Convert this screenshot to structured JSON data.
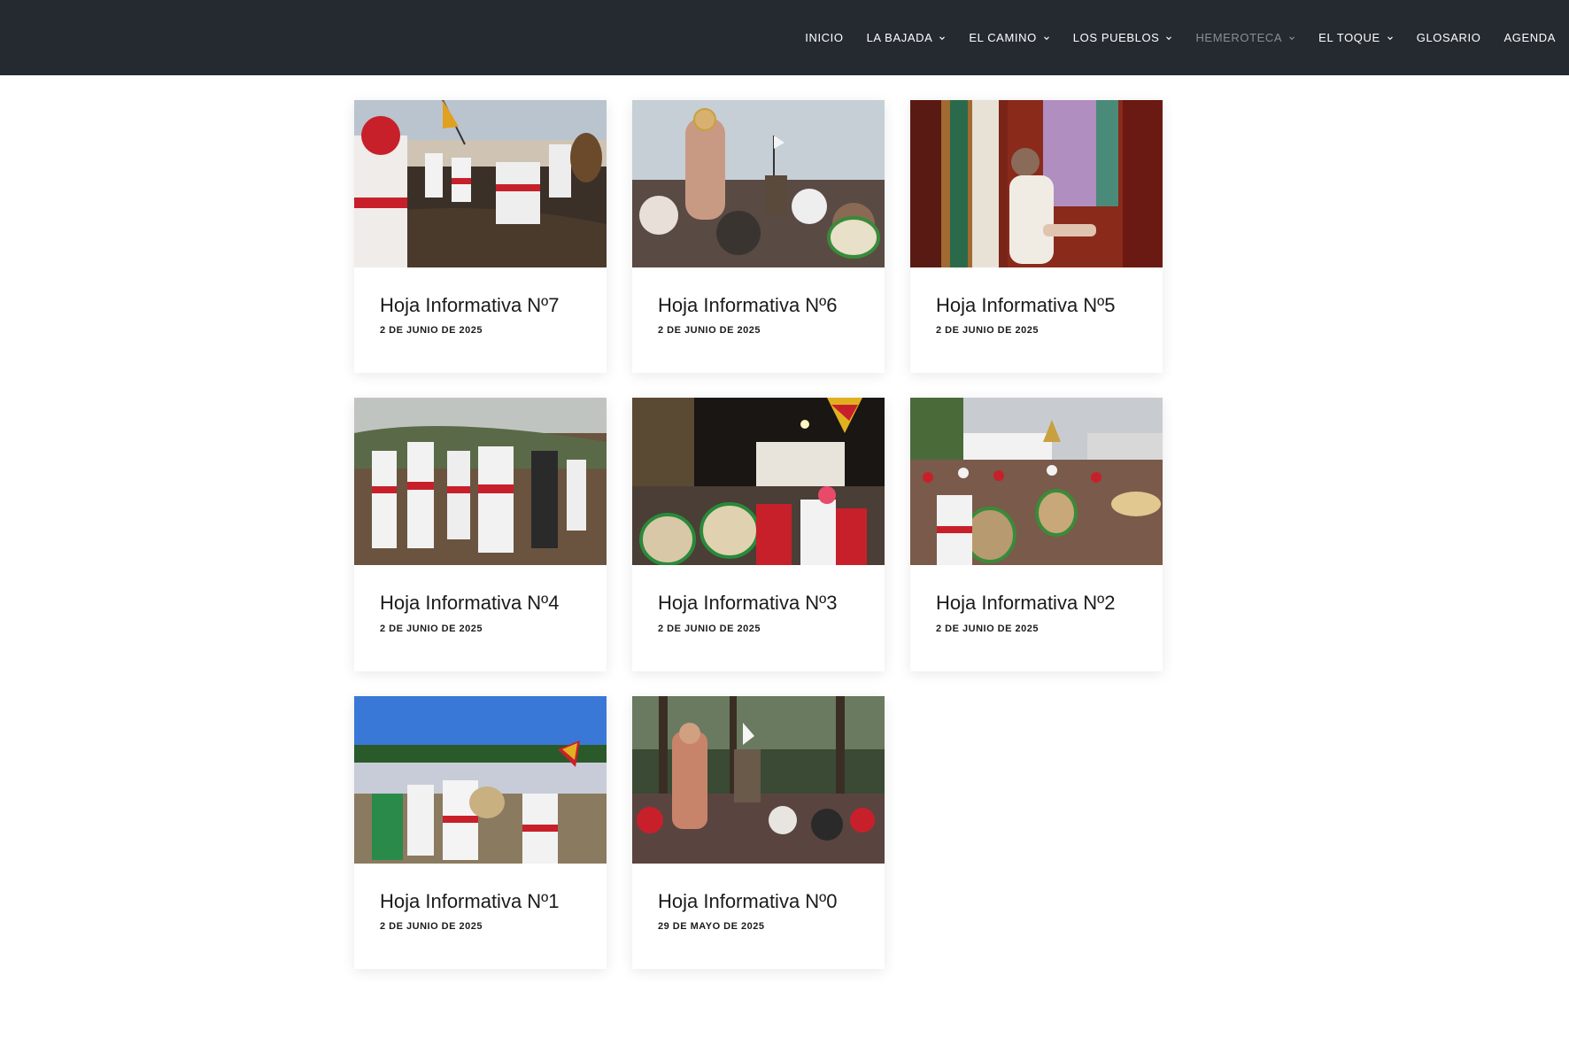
{
  "nav": {
    "items": [
      {
        "label": "INICIO",
        "dropdown": false,
        "active": false
      },
      {
        "label": "LA BAJADA",
        "dropdown": true,
        "active": false
      },
      {
        "label": "EL CAMINO",
        "dropdown": true,
        "active": false
      },
      {
        "label": "LOS PUEBLOS",
        "dropdown": true,
        "active": false
      },
      {
        "label": "HEMEROTECA",
        "dropdown": true,
        "active": true
      },
      {
        "label": "EL TOQUE",
        "dropdown": true,
        "active": false
      },
      {
        "label": "GLOSARIO",
        "dropdown": false,
        "active": false
      },
      {
        "label": "AGENDA",
        "dropdown": false,
        "active": false
      }
    ]
  },
  "posts": [
    {
      "title": "Hoja Informativa Nº7",
      "date": "2 DE JUNIO DE 2025",
      "photo": "dancers-kneeling-photo"
    },
    {
      "title": "Hoja Informativa Nº6",
      "date": "2 DE JUNIO DE 2025",
      "photo": "virgin-statue-crowd-photo"
    },
    {
      "title": "Hoja Informativa Nº5",
      "date": "2 DE JUNIO DE 2025",
      "photo": "woman-opening-shrine-photo"
    },
    {
      "title": "Hoja Informativa Nº4",
      "date": "2 DE JUNIO DE 2025",
      "photo": "dancers-hillside-photo"
    },
    {
      "title": "Hoja Informativa Nº3",
      "date": "2 DE JUNIO DE 2025",
      "photo": "night-drummers-photo"
    },
    {
      "title": "Hoja Informativa Nº2",
      "date": "2 DE JUNIO DE 2025",
      "photo": "street-procession-photo"
    },
    {
      "title": "Hoja Informativa Nº1",
      "date": "2 DE JUNIO DE 2025",
      "photo": "crowd-field-photo"
    },
    {
      "title": "Hoja Informativa Nº0",
      "date": "29 DE MAYO DE 2025",
      "photo": "forest-procession-photo"
    }
  ],
  "colors": {
    "topbar": "#252a30",
    "nav_text": "#ffffff",
    "nav_active": "#8b8f94",
    "festival_red": "#c8202a",
    "festival_white": "#f2f2f2"
  }
}
